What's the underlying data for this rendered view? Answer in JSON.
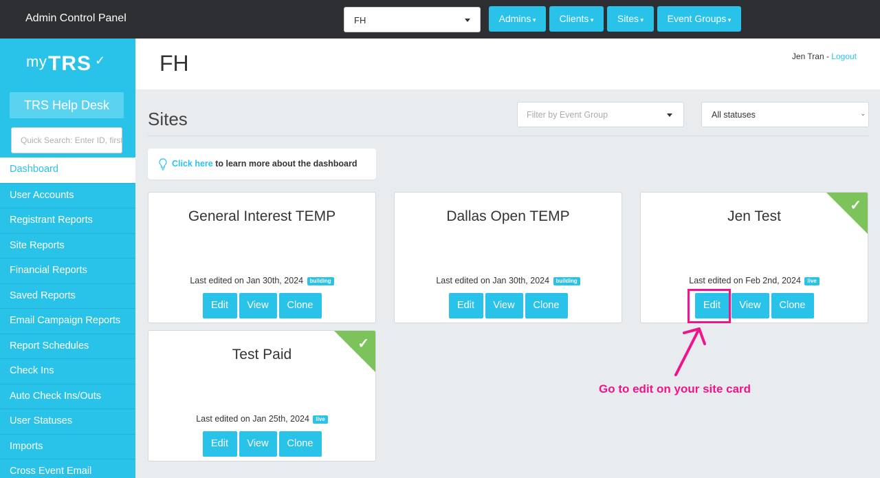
{
  "topbar": {
    "title": "Admin Control Panel",
    "client_select": "FH",
    "menus": [
      {
        "label": "Admins"
      },
      {
        "label": "Clients"
      },
      {
        "label": "Sites"
      },
      {
        "label": "Event Groups"
      }
    ]
  },
  "sidebar": {
    "logo_my": "my",
    "logo_trs": "TRS",
    "helpdesk": "TRS Help Desk",
    "quick_search_placeholder": "Quick Search: Enter ID, first name...",
    "items": [
      {
        "label": "Dashboard"
      },
      {
        "label": "User Accounts"
      },
      {
        "label": "Registrant Reports"
      },
      {
        "label": "Site Reports"
      },
      {
        "label": "Financial Reports"
      },
      {
        "label": "Saved Reports"
      },
      {
        "label": "Email Campaign Reports"
      },
      {
        "label": "Report Schedules"
      },
      {
        "label": "Check Ins"
      },
      {
        "label": "Auto Check Ins/Outs"
      },
      {
        "label": "User Statuses"
      },
      {
        "label": "Imports"
      },
      {
        "label": "Cross Event Email"
      }
    ]
  },
  "header": {
    "page_title": "FH",
    "user_name": "Jen Tran",
    "separator": " - ",
    "logout": "Logout"
  },
  "sites": {
    "title": "Sites",
    "filter_event_group_placeholder": "Filter by Event Group",
    "status_filter": "All statuses",
    "tip_link": "Click here",
    "tip_text": " to learn more about the dashboard",
    "cards": [
      {
        "name": "General Interest TEMP",
        "edited": "Last edited on Jan 30th, 2024",
        "status": "building",
        "edit": "Edit",
        "view": "View",
        "clone": "Clone"
      },
      {
        "name": "Dallas Open TEMP",
        "edited": "Last edited on Jan 30th, 2024",
        "status": "building",
        "edit": "Edit",
        "view": "View",
        "clone": "Clone"
      },
      {
        "name": "Jen Test",
        "edited": "Last edited on Feb 2nd, 2024",
        "status": "live",
        "edit": "Edit",
        "view": "View",
        "clone": "Clone"
      },
      {
        "name": "Test Paid",
        "edited": "Last edited on Jan 25th, 2024",
        "status": "live",
        "edit": "Edit",
        "view": "View",
        "clone": "Clone"
      }
    ]
  },
  "annotation": {
    "text": "Go to edit on your site card",
    "color": "#f0148c"
  },
  "colors": {
    "accent": "#29c3ea",
    "topbar": "#2d2f33",
    "live_corner": "#7dc35b"
  }
}
